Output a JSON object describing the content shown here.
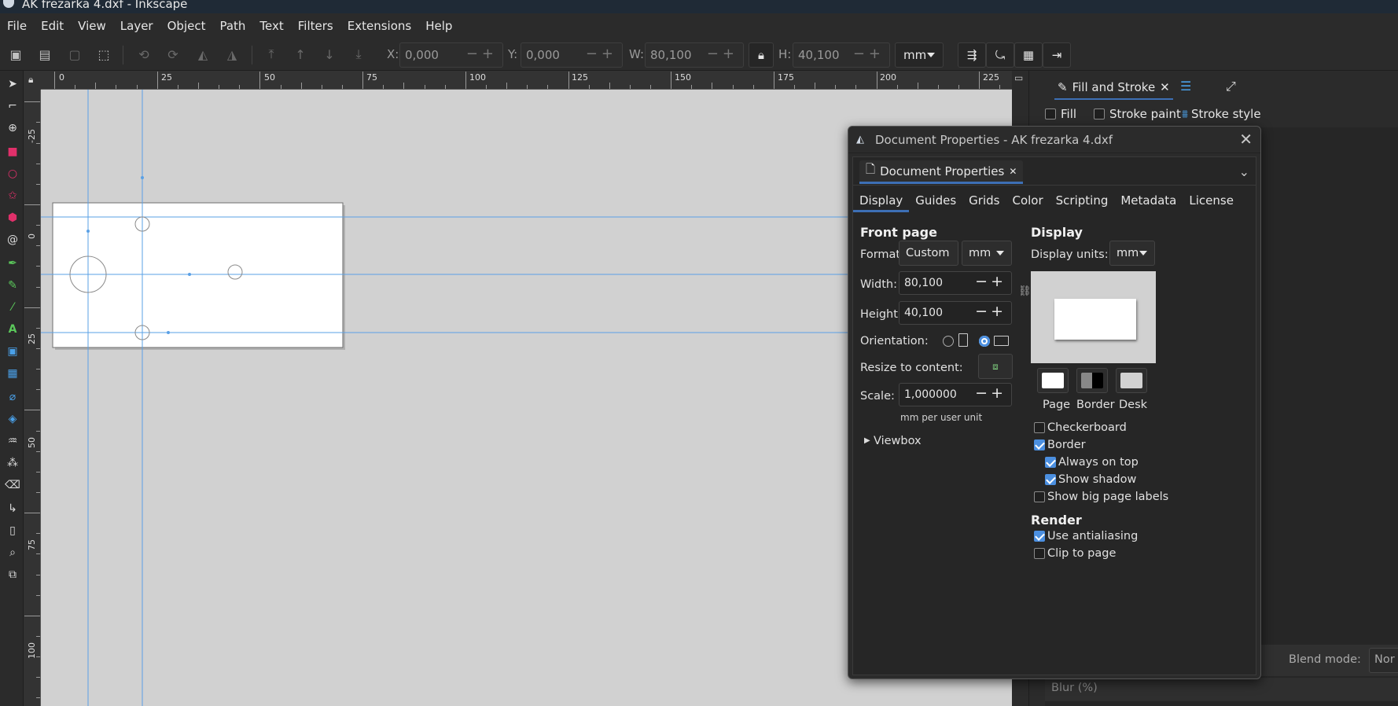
{
  "window": {
    "title": "AK frezarka 4.dxf - Inkscape"
  },
  "menu": [
    "File",
    "Edit",
    "View",
    "Layer",
    "Object",
    "Path",
    "Text",
    "Filters",
    "Extensions",
    "Help"
  ],
  "toolbar": {
    "x_label": "X:",
    "x_value": "0,000",
    "y_label": "Y:",
    "y_value": "0,000",
    "w_label": "W:",
    "w_value": "80,100",
    "h_label": "H:",
    "h_value": "40,100",
    "unit": "mm"
  },
  "ruler": {
    "h_labels": [
      "0",
      "25",
      "50",
      "75",
      "100",
      "125",
      "150",
      "175",
      "200",
      "225"
    ],
    "v_labels": [
      "-25",
      "0",
      "25",
      "50",
      "75",
      "100"
    ]
  },
  "dock": {
    "active_tab": "Fill and Stroke",
    "sub_tabs": [
      "Fill",
      "Stroke paint",
      "Stroke style"
    ],
    "blend_label": "Blend mode:",
    "blend_value": "Nor",
    "blur_label": "Blur (%)"
  },
  "dialog": {
    "title": "Document Properties - AK frezarka 4.dxf",
    "tab": "Document Properties",
    "subtabs": [
      "Display",
      "Guides",
      "Grids",
      "Color",
      "Scripting",
      "Metadata",
      "License"
    ],
    "front_page": {
      "title": "Front page",
      "format_label": "Format:",
      "format_value": "Custom",
      "format_unit": "mm",
      "width_label": "Width:",
      "width_value": "80,100",
      "height_label": "Height:",
      "height_value": "40,100",
      "orientation_label": "Orientation:",
      "resize_label": "Resize to content:",
      "scale_label": "Scale:",
      "scale_value": "1,000000",
      "scale_unit": "mm per user unit",
      "viewbox": "Viewbox"
    },
    "display": {
      "title": "Display",
      "units_label": "Display units:",
      "units_value": "mm",
      "swatches": [
        "Page",
        "Border",
        "Desk"
      ],
      "checks": [
        {
          "label": "Checkerboard",
          "checked": false
        },
        {
          "label": "Border",
          "checked": true
        },
        {
          "label": "Always on top",
          "checked": true
        },
        {
          "label": "Show shadow",
          "checked": true
        },
        {
          "label": "Show big page labels",
          "checked": false
        }
      ]
    },
    "render": {
      "title": "Render",
      "checks": [
        {
          "label": "Use antialiasing",
          "checked": true
        },
        {
          "label": "Clip to page",
          "checked": false
        }
      ]
    }
  },
  "colors": {
    "accent": "#3d6fb5",
    "guide": "#5aa0e6",
    "canvas": "#d1d1d1"
  }
}
